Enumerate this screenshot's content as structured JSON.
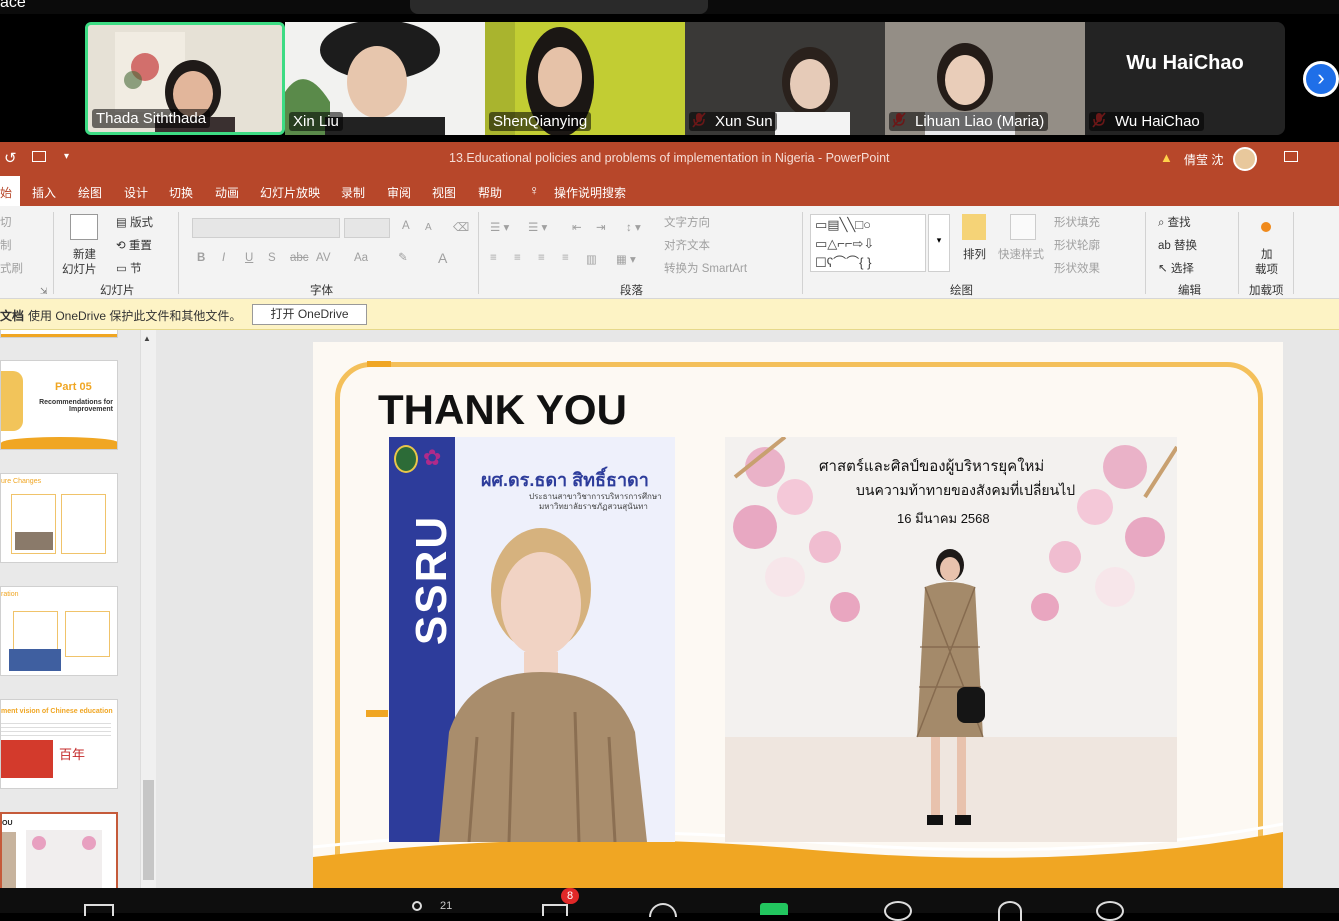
{
  "topbar": {
    "left_label": "ace"
  },
  "participants": [
    {
      "name": "Thada Siththada",
      "muted": false,
      "active": true
    },
    {
      "name": "Xin Liu",
      "muted": false,
      "active": false
    },
    {
      "name": "ShenQianying",
      "muted": false,
      "active": false
    },
    {
      "name": "Xun Sun",
      "muted": true,
      "active": false
    },
    {
      "name": "Lihuan Liao (Maria)",
      "muted": true,
      "active": false
    },
    {
      "name": "Wu HaiChao",
      "muted": true,
      "active": false,
      "display": "Wu HaiChao"
    }
  ],
  "next_button": "›",
  "window": {
    "title": "13.Educational policies and problems of implementation in Nigeria - PowerPoint",
    "user": "倩莹 沈",
    "warning_icon": "warning-icon"
  },
  "tabs": [
    "始",
    "插入",
    "绘图",
    "设计",
    "切换",
    "动画",
    "幻灯片放映",
    "录制",
    "审阅",
    "视图",
    "帮助",
    "操作说明搜索"
  ],
  "ribbon": {
    "clipboard": {
      "cut": "切",
      "copy": "制",
      "format": "式刷"
    },
    "slides": {
      "new_label_1": "新建",
      "new_label_2": "幻灯片",
      "layout": "版式",
      "reset": "重置",
      "section": "节",
      "group": "幻灯片"
    },
    "font": {
      "group": "字体",
      "bold": "B",
      "italic": "I",
      "underline": "U",
      "shadow": "S",
      "strike": "abc",
      "spacing": "AV",
      "case": "Aa",
      "grow": "A",
      "shrink": "A",
      "color": "A"
    },
    "paragraph": {
      "group": "段落",
      "text_direction": "文字方向",
      "align_text": "对齐文本",
      "smartart": "转换为 SmartArt"
    },
    "drawing": {
      "group": "绘图",
      "arrange": "排列",
      "quick_styles": "快速样式",
      "fill": "形状填充",
      "outline": "形状轮廓",
      "effects": "形状效果"
    },
    "editing": {
      "group": "编辑",
      "find": "查找",
      "replace": "替换",
      "select": "选择"
    },
    "addins": {
      "group": "加载项",
      "label_1": "加",
      "label_2": "载项"
    }
  },
  "message_bar": {
    "prefix": "文档",
    "text": "使用 OneDrive 保护此文件和其他文件。",
    "button": "打开 OneDrive"
  },
  "thumbnails": [
    {
      "title": "Part 05",
      "subtitle": "Recommendations for Improvement"
    },
    {
      "title": "ure Changes"
    },
    {
      "title": "ration"
    },
    {
      "title": "ment vision of Chinese education"
    },
    {
      "title": "OU"
    }
  ],
  "slide": {
    "heading": "THANK YOU",
    "poster_brand": "SSRU",
    "poster_name": "ผศ.ดร.ธดา สิทธิ์ธาดา",
    "poster_caption_1": "ประธานสาขาวิชาการบริหารการศึกษา",
    "poster_caption_2": "มหาวิทยาลัยราชภัฏสวนสุนันทา",
    "event_line_1": "ศาสตร์และศิลป์ของผู้บริหารยุคใหม่",
    "event_line_2": "บนความท้าทายของสังคมที่เปลี่ยนไป",
    "event_date": "16 มีนาคม 2568"
  },
  "bottom": {
    "participants_count": "21",
    "chat_badge": "8"
  },
  "colors": {
    "ppt_accent": "#b7472a",
    "slide_orange": "#f0a623",
    "poster_blue": "#2d3c9b",
    "active_border": "#3ddc84"
  }
}
